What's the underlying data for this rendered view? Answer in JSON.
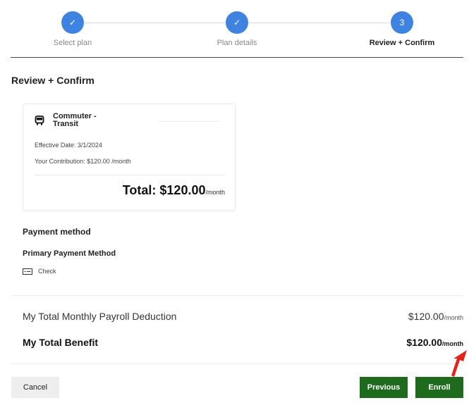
{
  "stepper": {
    "steps": [
      {
        "label": "Select plan",
        "marker": "✓"
      },
      {
        "label": "Plan details",
        "marker": "✓"
      },
      {
        "label": "Review + Confirm",
        "marker": "3"
      }
    ],
    "color": "#3f83e0"
  },
  "page": {
    "title": "Review + Confirm"
  },
  "plan_card": {
    "icon": "bus-icon",
    "title": "Commuter - Transit",
    "effective_date": "Effective Date: 3/1/2024",
    "contribution": "Your Contribution: $120.00 /month",
    "total_label": "Total: $120.00",
    "total_unit": "/month"
  },
  "payment": {
    "title": "Payment method",
    "primary_label": "Primary Payment Method",
    "method_icon": "check-icon",
    "method": "Check"
  },
  "summary": {
    "payroll_label": "My Total Monthly Payroll Deduction",
    "payroll_value": "$120.00",
    "payroll_unit": "/month",
    "benefit_label": "My Total Benefit",
    "benefit_value": "$120.00",
    "benefit_unit": "/month"
  },
  "buttons": {
    "cancel": "Cancel",
    "previous": "Previous",
    "enroll": "Enroll",
    "primary_color": "#1e6b1e"
  }
}
